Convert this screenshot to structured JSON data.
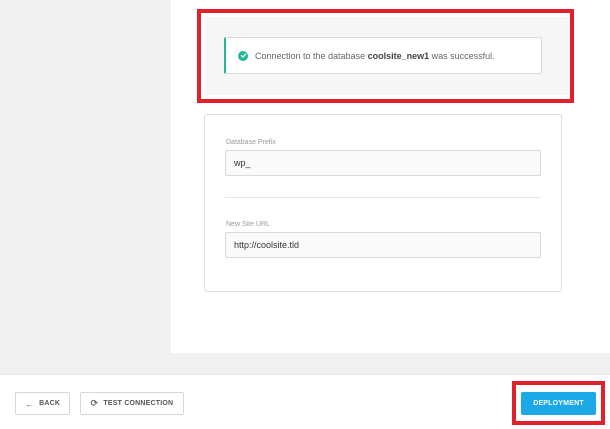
{
  "success_alert": {
    "prefix": "Connection to the database ",
    "db_name": "coolsite_new1",
    "suffix": " was successful.",
    "icon": "check-circle-icon",
    "accent": "#22b894"
  },
  "form": {
    "prefix_label": "Database Prefix",
    "prefix_value": "wp_",
    "url_label": "New Site URL",
    "url_value": "http://coolsite.tld"
  },
  "footer": {
    "back_label": "BACK",
    "back_icon": "arrow-left-icon",
    "test_label": "TEST CONNECTION",
    "test_icon": "refresh-icon",
    "deploy_label": "DEPLOYMENT",
    "deploy_color": "#1aa9e6"
  },
  "highlight_color": "#e0202a"
}
